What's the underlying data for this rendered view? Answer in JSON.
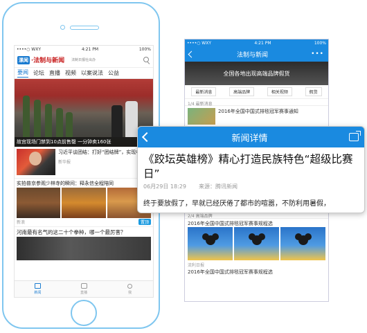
{
  "phone": {
    "status": {
      "carrier": "••••○ WXY",
      "time": "4:21 PM",
      "battery": "100%"
    },
    "logo": {
      "badge": "新",
      "badge2": "漯闻",
      "name": "·法制与新闻"
    },
    "slogan": "法制日报社出办",
    "tabs": [
      "要闻",
      "论坛",
      "直播",
      "视频",
      "以案说法",
      "公益"
    ],
    "hero_caption": "故宫现场门禁到10点前售罄 一分钟卖160张",
    "item1": {
      "title": "习近平谈团结：打好“团结牌”，实现中国梦",
      "source": "新华报"
    },
    "item2": {
      "title": "实拍普京参观少林寺的瞬间：释永信全程陪同",
      "source": "新浪",
      "badge": "置顶"
    },
    "item3": {
      "title": "河南最有名气的这二十个拳种，哪一个最厉害？"
    },
    "bottom_nav": [
      "新闻",
      "直播",
      "我"
    ]
  },
  "screen2": {
    "status": {
      "carrier": "••••○ WXY",
      "time": "4:21 PM",
      "battery": "100%"
    },
    "title": "法制与新闻",
    "more": "•••",
    "banner": "全国各地出现高端品牌假货",
    "cats": [
      "最新消息",
      "高端品牌",
      "相关视频",
      "假货"
    ],
    "section1": "1/4  最新消息",
    "news1": "2016年全国中国式排毯冠军赛事通知",
    "section2": "2/4  高端品牌",
    "row_title": "2016年全国中国式排毯冠军赛事规程选",
    "meta": "流利日报",
    "row_title2": "2016年全国中国式排毯冠军赛事规程选"
  },
  "detail": {
    "header_title": "新闻详情",
    "title": "《跤坛英雄榜》精心打造民族特色“超级比赛日”",
    "date": "06月29日  18:29",
    "source": "来源：腾讯新闻",
    "body": "终于要放假了，早就已经厌倦了都市的喧嚣，不防利用暑假，"
  }
}
